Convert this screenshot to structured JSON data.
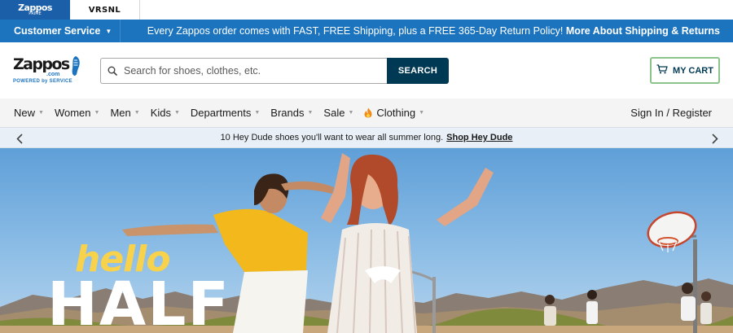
{
  "brand_tabs": {
    "zappos": {
      "label": "Zappos",
      "sub": "PRIME"
    },
    "vrsnl": {
      "label": "VRSNL"
    }
  },
  "promo_bar": {
    "customer_service": "Customer Service",
    "message": "Every Zappos order comes with FAST, FREE Shipping, plus a FREE 365-Day Return Policy!",
    "link": "More About Shipping & Returns"
  },
  "header": {
    "logo": {
      "word": "Zappos",
      "com": ".com",
      "tagline": "POWERED by SERVICE"
    },
    "search": {
      "placeholder": "Search for shoes, clothes, etc.",
      "value": ""
    },
    "search_button": "SEARCH",
    "cart_label": "MY CART"
  },
  "nav": {
    "items": [
      {
        "label": "New"
      },
      {
        "label": "Women"
      },
      {
        "label": "Men"
      },
      {
        "label": "Kids"
      },
      {
        "label": "Departments"
      },
      {
        "label": "Brands"
      },
      {
        "label": "Sale"
      },
      {
        "label": "Clothing"
      }
    ],
    "sign_in": "Sign In / Register"
  },
  "announcement": {
    "text": "10 Hey Dude shoes you'll want to wear all summer long.",
    "link": "Shop Hey Dude"
  },
  "hero": {
    "headline_top": "hello",
    "headline_bottom": "HALF"
  },
  "colors": {
    "brand_blue": "#1c74bf",
    "search_button": "#003953",
    "cart_border": "#8bc48a",
    "announce_bg": "#e8eff6",
    "hero_yellow": "#f8d24a"
  }
}
